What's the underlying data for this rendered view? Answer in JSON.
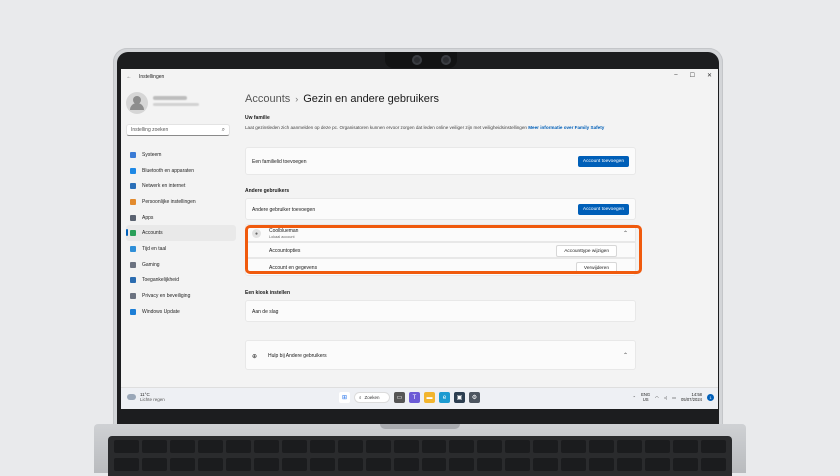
{
  "window": {
    "title": "Instellingen",
    "back": "←",
    "minimize": "–",
    "maximize": "☐",
    "close": "✕"
  },
  "account": {
    "avatar_icon": "user-avatar-icon"
  },
  "sidebar": {
    "search_placeholder": "Instelling zoeken",
    "items": [
      {
        "label": "Systeem",
        "icon": "monitor-icon",
        "color": "#3a7bd5"
      },
      {
        "label": "Bluetooth en apparaten",
        "icon": "bluetooth-icon",
        "color": "#1e88e5"
      },
      {
        "label": "Netwerk en internet",
        "icon": "wifi-icon",
        "color": "#2a6fb8"
      },
      {
        "label": "Persoonlijke instellingen",
        "icon": "brush-icon",
        "color": "#e28a2d"
      },
      {
        "label": "Apps",
        "icon": "apps-icon",
        "color": "#5a6270"
      },
      {
        "label": "Accounts",
        "icon": "person-icon",
        "color": "#2aa05a",
        "active": true
      },
      {
        "label": "Tijd en taal",
        "icon": "globe-clock-icon",
        "color": "#2f8fd8"
      },
      {
        "label": "Gaming",
        "icon": "controller-icon",
        "color": "#6b7280"
      },
      {
        "label": "Toegankelijkheid",
        "icon": "accessibility-icon",
        "color": "#2b6cb0"
      },
      {
        "label": "Privacy en beveiliging",
        "icon": "shield-icon",
        "color": "#6b7280"
      },
      {
        "label": "Windows Update",
        "icon": "update-icon",
        "color": "#1c7ed6"
      }
    ]
  },
  "main": {
    "breadcrumb_parent": "Accounts",
    "breadcrumb_sep": "›",
    "breadcrumb_current": "Gezin en andere gebruikers",
    "family_heading": "Uw familie",
    "family_desc": "Laat gezinsleden zich aanmelden op deze pc. Organisatoren kunnen ervoor zorgen dat leden online veiliger zijn met veiligheidsinstellingen",
    "family_link": "Meer informatie over Family Safety",
    "add_family_label": "Een familielid toevoegen",
    "add_account_btn": "Account toevoegen",
    "other_users_heading": "Andere gebruikers",
    "add_other_label": "Andere gebruiker toevoegen",
    "add_account_btn2": "Account toevoegen",
    "user_name": "Coolblueman",
    "user_type": "Lokaal account",
    "expand_icon": "⌃",
    "account_options_label": "Accountopties",
    "change_type_btn": "Accounttype wijzigen",
    "account_data_label": "Account en gegevens",
    "remove_btn": "Verwijderen",
    "kiosk_heading": "Een kiosk instellen",
    "kiosk_label": "Aan de slag",
    "help_label": "Hulp bij Andere gebruikers"
  },
  "taskbar": {
    "temp": "11°C",
    "weather": "Lichte regen",
    "search_label": "Zoeken",
    "lang1": "ENG",
    "lang2": "US",
    "time": "14:58",
    "date": "05/07/2024",
    "notif_count": "1"
  }
}
